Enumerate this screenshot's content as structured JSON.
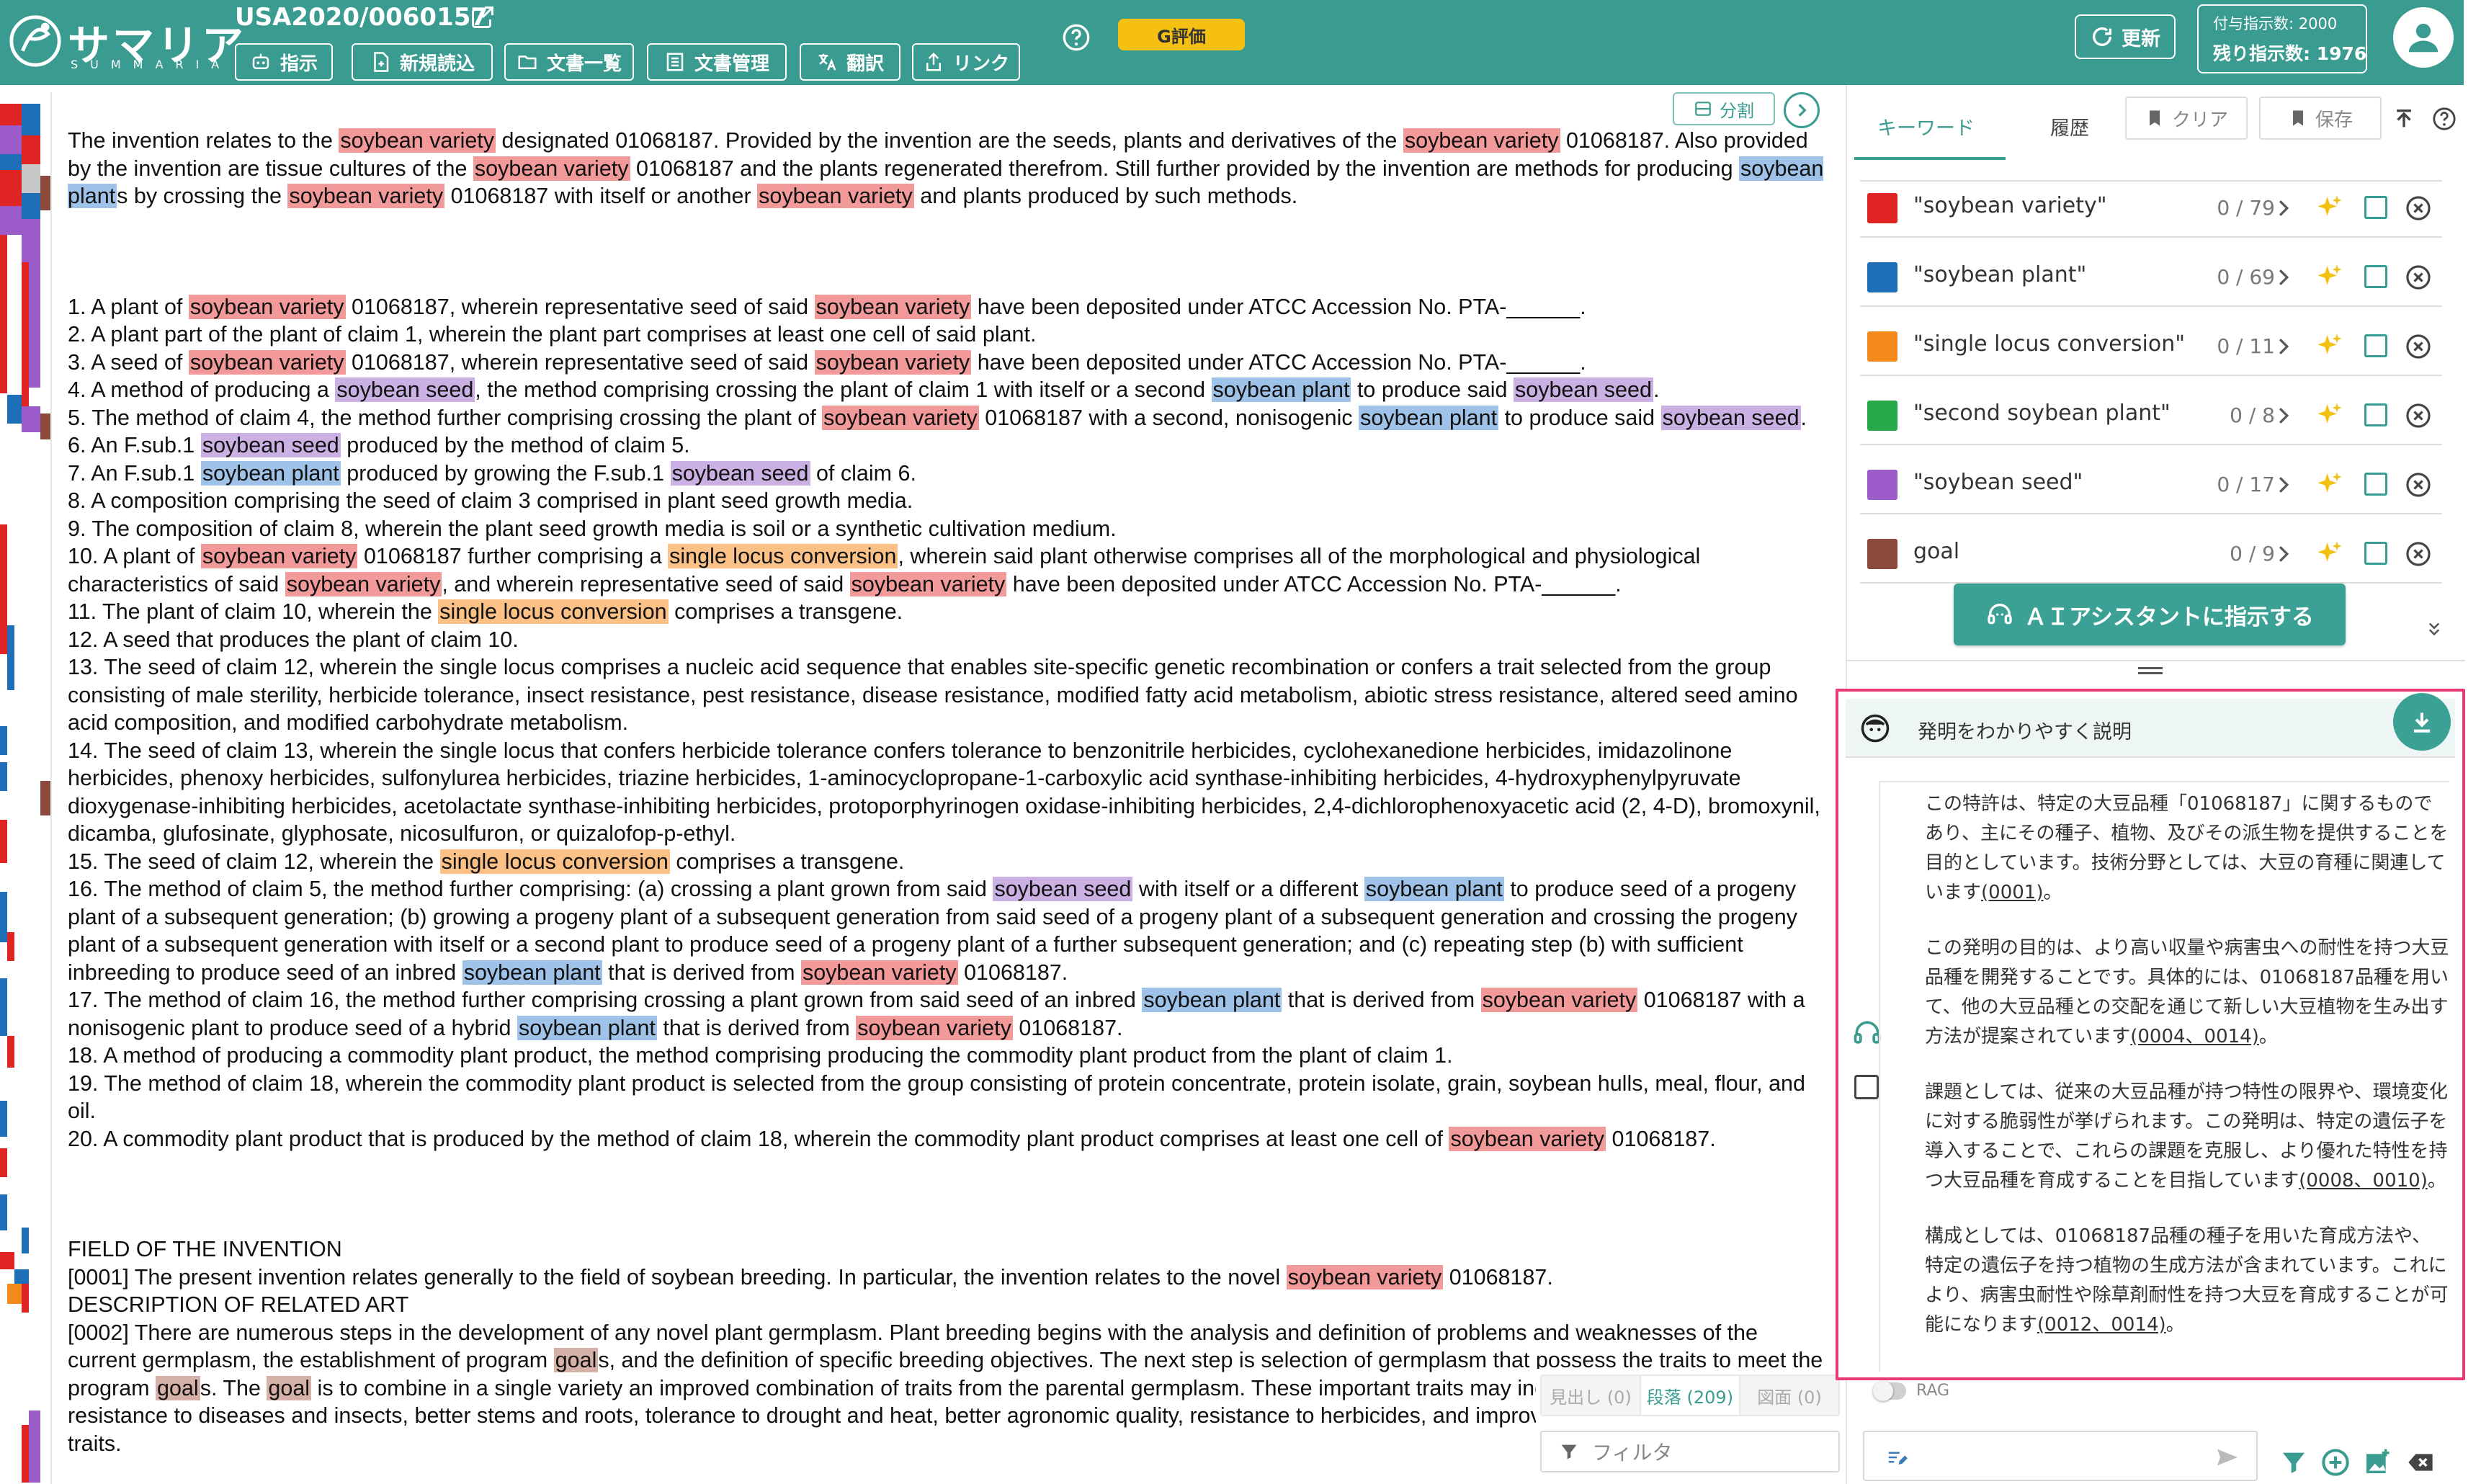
{
  "header": {
    "logo_jp": "サマリア",
    "logo_en": "SUMMARIA",
    "doc_id": "USA2020/0060157",
    "nav": [
      "指示",
      "新規読込",
      "文書一覧",
      "文書管理",
      "翻訳",
      "リンク"
    ],
    "g_eval": "G評価",
    "refresh": "更新",
    "quota_line1": "付与指示数: 2000",
    "quota_line2": "残り指示数: 1976"
  },
  "doc": {
    "split_label": "分割",
    "abstract": "The invention relates to the [[1|soybean variety]] designated 01068187. Provided by the invention are the seeds, plants and derivatives of the [[1|soybean variety]] 01068187. Also provided by the invention are tissue cultures of the [[1|soybean variety]] 01068187 and the plants regenerated therefrom. Still further provided by the invention are methods for producing [[2|soybean plant]]s by crossing the [[1|soybean variety]] 01068187 with itself or another [[1|soybean variety]] and plants produced by such methods.",
    "claims": [
      "1. A plant of [[1|soybean variety]] 01068187, wherein representative seed of said [[1|soybean variety]] have been deposited under ATCC Accession No. PTA-______.",
      "2. A plant part of the plant of claim 1, wherein the plant part comprises at least one cell of said plant.",
      "3. A seed of [[1|soybean variety]] 01068187, wherein representative seed of said [[1|soybean variety]] have been deposited under ATCC Accession No. PTA-______.",
      "4. A method of producing a [[5|soybean seed]], the method comprising crossing the plant of claim 1 with itself or a second [[2|soybean plant]] to produce said [[5|soybean seed]].",
      "5. The method of claim 4, the method further comprising crossing the plant of [[1|soybean variety]] 01068187 with a second, nonisogenic [[2|soybean plant]] to produce said [[5|soybean seed]].",
      "6. An F.sub.1 [[5|soybean seed]] produced by the method of claim 5.",
      "7. An F.sub.1 [[2|soybean plant]] produced by growing the F.sub.1 [[5|soybean seed]] of claim 6.",
      "8. A composition comprising the seed of claim 3 comprised in plant seed growth media.",
      "9. The composition of claim 8, wherein the plant seed growth media is soil or a synthetic cultivation medium.",
      "10. A plant of [[1|soybean variety]] 01068187 further comprising a [[3|single locus conversion]], wherein said plant otherwise comprises all of the morphological and physiological characteristics of said [[1|soybean variety]], and wherein representative seed of said [[1|soybean variety]] have been deposited under ATCC Accession No. PTA-______.",
      "11. The plant of claim 10, wherein the [[3|single locus conversion]] comprises a transgene.",
      "12. A seed that produces the plant of claim 10.",
      "13. The seed of claim 12, wherein the single locus comprises a nucleic acid sequence that enables site-specific genetic recombination or confers a trait selected from the group consisting of male sterility, herbicide tolerance, insect resistance, pest resistance, disease resistance, modified fatty acid metabolism, abiotic stress resistance, altered seed amino acid composition, and modified carbohydrate metabolism.",
      "14. The seed of claim 13, wherein the single locus that confers herbicide tolerance confers tolerance to benzonitrile herbicides, cyclohexanedione herbicides, imidazolinone herbicides, phenoxy herbicides, sulfonylurea herbicides, triazine herbicides, 1-aminocyclopropane-1-carboxylic acid synthase-inhibiting herbicides, 4-hydroxyphenylpyruvate dioxygenase-inhibiting herbicides, acetolactate synthase-inhibiting herbicides, protoporphyrinogen oxidase-inhibiting herbicides, 2,4-dichlorophenoxyacetic acid (2, 4-D), bromoxynil, dicamba, glufosinate, glyphosate, nicosulfuron, or quizalofop-p-ethyl.",
      "15. The seed of claim 12, wherein the [[3|single locus conversion]] comprises a transgene.",
      "16. The method of claim 5, the method further comprising: (a) crossing a plant grown from said [[5|soybean seed]] with itself or a different [[2|soybean plant]] to produce seed of a progeny plant of a subsequent generation; (b) growing a progeny plant of a subsequent generation from said seed of a progeny plant of a subsequent generation and crossing the progeny plant of a subsequent generation with itself or a second plant to produce seed of a progeny plant of a further subsequent generation; and (c) repeating step (b) with sufficient inbreeding to produce seed of an inbred [[2|soybean plant]] that is derived from [[1|soybean variety]] 01068187.",
      "17. The method of claim 16, the method further comprising crossing a plant grown from said seed of an inbred [[2|soybean plant]] that is derived from [[1|soybean variety]] 01068187 with a nonisogenic plant to produce seed of a hybrid [[2|soybean plant]] that is derived from [[1|soybean variety]] 01068187.",
      "18. A method of producing a commodity plant product, the method comprising producing the commodity plant product from the plant of claim 1.",
      "19. The method of claim 18, wherein the commodity plant product is selected from the group consisting of protein concentrate, protein isolate, grain, soybean hulls, meal, flour, and oil.",
      "20. A commodity plant product that is produced by the method of claim 18, wherein the commodity plant product comprises at least one cell of [[1|soybean variety]] 01068187."
    ],
    "body": [
      "FIELD OF THE INVENTION",
      "[0001] The present invention relates generally to the field of soybean breeding. In particular, the invention relates to the novel [[1|soybean variety]] 01068187.",
      "DESCRIPTION OF RELATED ART",
      "[0002] There are numerous steps in the development of any novel plant germplasm. Plant breeding begins with the analysis and definition of problems and weaknesses of the current germplasm, the establishment of program [[6|goal]]s, and the definition of specific breeding objectives. The next step is selection of germplasm that possess the traits to meet the program [[6|goal]]s. The [[6|goal]] is to combine in a single variety an improved combination of traits from the parental germplasm. These important traits may include higher seed yield, resistance to diseases and insects, better stems and roots, tolerance to drought and heat, better agronomic quality, resistance to herbicides, and improvements in compositional traits."
    ],
    "tabs": [
      "見出し (0)",
      "段落 (209)",
      "図面 (0)"
    ],
    "filter_placeholder": "フィルタ"
  },
  "panel": {
    "tab_keyword": "キーワード",
    "tab_history": "履歴",
    "clear": "クリア",
    "save": "保存",
    "keywords": [
      {
        "name": "\"soybean variety\"",
        "count": "0 / 79",
        "color": "#e02424"
      },
      {
        "name": "\"soybean plant\"",
        "count": "0 / 69",
        "color": "#1f6fb8"
      },
      {
        "name": "\"single locus conversion\"",
        "count": "0 / 11",
        "color": "#f48a1c"
      },
      {
        "name": "\"second soybean plant\"",
        "count": "0 / 8",
        "color": "#27a84a"
      },
      {
        "name": "\"soybean seed\"",
        "count": "0 / 17",
        "color": "#9b5bc8"
      },
      {
        "name": "goal",
        "count": "0 / 9",
        "color": "#8b4a3c"
      }
    ],
    "ai_button": "ＡＩアシスタントに指示する",
    "ai_title": "発明をわかりやすく説明",
    "ai_paragraphs": [
      "この特許は、特定の大豆品種「01068187」に関するものであり、主にその種子、植物、及びその派生物を提供することを目的としています。技術分野としては、大豆の育種に関連しています[[(0001)]]。",
      "この発明の目的は、より高い収量や病害虫への耐性を持つ大豆品種を開発することです。具体的には、01068187品種を用いて、他の大豆品種との交配を通じて新しい大豆植物を生み出す方法が提案されています[[(0004、0014)]]。",
      "課題としては、従来の大豆品種が持つ特性の限界や、環境変化に対する脆弱性が挙げられます。この発明は、特定の遺伝子を導入することで、これらの課題を克服し、より優れた特性を持つ大豆品種を育成することを目指しています[[(0008、0010)]]。",
      "構成としては、01068187品種の種子を用いた育成方法や、特定の遺伝子を持つ植物の生成方法が含まれています。これにより、病害虫耐性や除草剤耐性を持つ大豆を育成することが可能になります[[(0012、0014)]]。"
    ],
    "rag_label": "RAG"
  },
  "colors": {
    "brand": "#3a9b90",
    "highlight_box": "#e83a78"
  }
}
